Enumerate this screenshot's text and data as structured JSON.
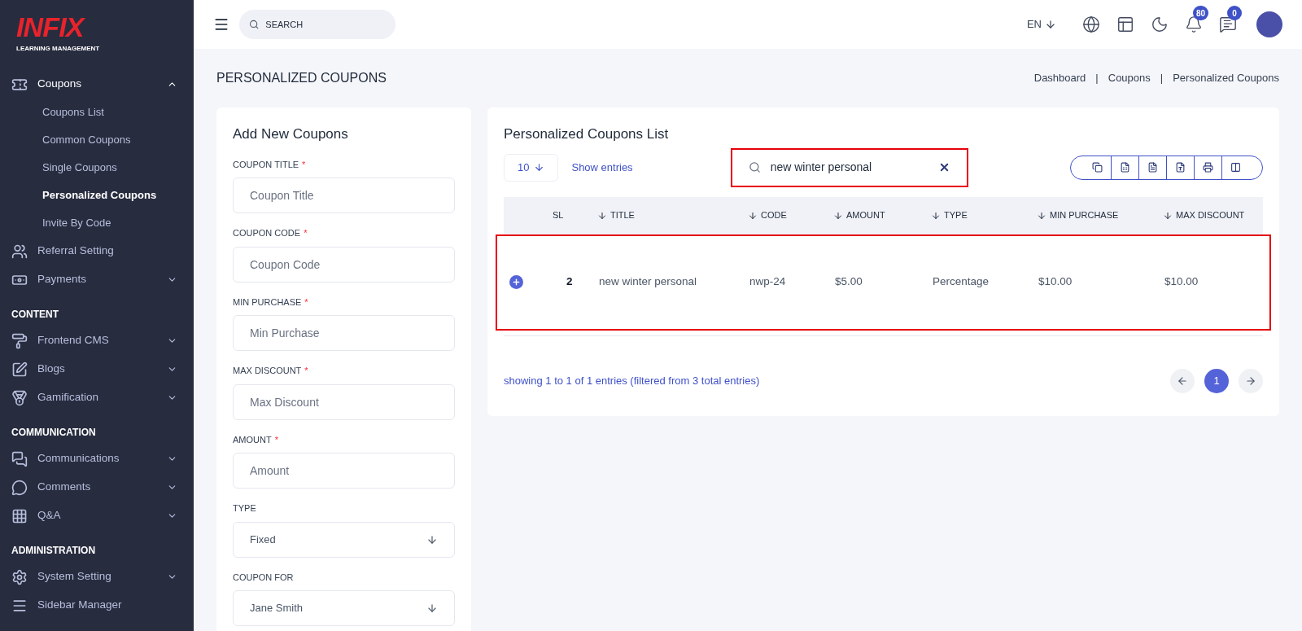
{
  "sidebar": {
    "logo": {
      "name": "INFIX",
      "tagline": "LEARNING MANAGEMENT"
    },
    "items": [
      {
        "kind": "item",
        "label": "Coupons",
        "expanded": true,
        "children": [
          {
            "label": "Coupons List",
            "selected": false
          },
          {
            "label": "Common Coupons",
            "selected": false
          },
          {
            "label": "Single Coupons",
            "selected": false
          },
          {
            "label": "Personalized Coupons",
            "selected": true
          },
          {
            "label": "Invite By Code",
            "selected": false
          }
        ]
      },
      {
        "kind": "item",
        "label": "Referral Setting",
        "expanded": false,
        "has_caret": false
      },
      {
        "kind": "item",
        "label": "Payments",
        "expanded": false,
        "has_caret": true
      },
      {
        "kind": "section",
        "label": "CONTENT"
      },
      {
        "kind": "item",
        "label": "Frontend CMS",
        "expanded": false,
        "has_caret": true
      },
      {
        "kind": "item",
        "label": "Blogs",
        "expanded": false,
        "has_caret": true
      },
      {
        "kind": "item",
        "label": "Gamification",
        "expanded": false,
        "has_caret": true
      },
      {
        "kind": "section",
        "label": "COMMUNICATION"
      },
      {
        "kind": "item",
        "label": "Communications",
        "expanded": false,
        "has_caret": true
      },
      {
        "kind": "item",
        "label": "Comments",
        "expanded": false,
        "has_caret": true
      },
      {
        "kind": "item",
        "label": "Q&A",
        "expanded": false,
        "has_caret": true
      },
      {
        "kind": "section",
        "label": "ADMINISTRATION"
      },
      {
        "kind": "item",
        "label": "System Setting",
        "expanded": false,
        "has_caret": true
      },
      {
        "kind": "item",
        "label": "Sidebar Manager",
        "expanded": false,
        "has_caret": false
      }
    ]
  },
  "topbar": {
    "search": {
      "placeholder": "SEARCH"
    },
    "language": "EN",
    "notifications": "80",
    "messages": "0"
  },
  "page": {
    "title": "PERSONALIZED COUPONS",
    "breadcrumbs": [
      {
        "kind": "link",
        "text": "Dashboard"
      },
      {
        "kind": "separator",
        "text": "|"
      },
      {
        "kind": "link",
        "text": "Coupons"
      },
      {
        "kind": "separator",
        "text": "|"
      },
      {
        "kind": "link",
        "text": "Personalized Coupons"
      }
    ]
  },
  "form": {
    "title": "Add New Coupons",
    "fields": [
      {
        "kind": "input",
        "label": "COUPON TITLE",
        "required_mark": "*",
        "placeholder": "Coupon Title"
      },
      {
        "kind": "input",
        "label": "COUPON CODE",
        "required_mark": "*",
        "placeholder": "Coupon Code"
      },
      {
        "kind": "input",
        "label": "MIN PURCHASE",
        "required_mark": "*",
        "placeholder": "Min Purchase"
      },
      {
        "kind": "input",
        "label": "MAX DISCOUNT",
        "required_mark": "*",
        "placeholder": "Max Discount"
      },
      {
        "kind": "input",
        "label": "AMOUNT",
        "required_mark": "*",
        "placeholder": "Amount"
      },
      {
        "kind": "select",
        "label": "TYPE",
        "value": "Fixed"
      },
      {
        "kind": "select",
        "label": "COUPON FOR",
        "value": "Jane Smith"
      }
    ]
  },
  "list": {
    "title": "Personalized Coupons List",
    "page_size": "10",
    "show_entries": "Show entries",
    "search": {
      "value": "new winter personal",
      "highlighted": true
    },
    "columns": [
      {
        "label": "SL",
        "sortable": false
      },
      {
        "label": "TITLE",
        "sortable": true
      },
      {
        "label": "CODE",
        "sortable": true
      },
      {
        "label": "AMOUNT",
        "sortable": true
      },
      {
        "label": "TYPE",
        "sortable": true
      },
      {
        "label": "MIN PURCHASE",
        "sortable": true
      },
      {
        "label": "MAX DISCOUNT",
        "sortable": true
      }
    ],
    "rows": [
      {
        "highlighted": true,
        "cells": [
          "2",
          "new winter personal",
          "nwp-24",
          "$5.00",
          "Percentage",
          "$10.00",
          "$10.00"
        ]
      }
    ],
    "info": "showing 1 to 1 of 1 entries (filtered from 3 total entries)",
    "pages": [
      {
        "label": "1",
        "selected": true
      }
    ]
  }
}
